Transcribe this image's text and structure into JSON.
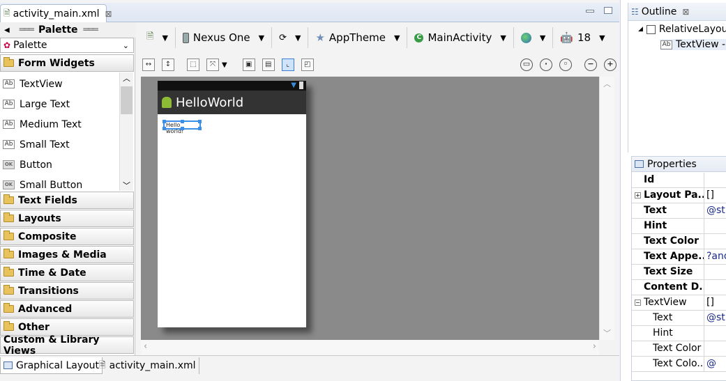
{
  "editor": {
    "tab_label": "activity_main.xml",
    "tab_close": "⊠"
  },
  "palette": {
    "title": "Palette",
    "selector": "Palette",
    "open_category": "Form Widgets",
    "widgets": [
      {
        "label": "TextView",
        "icon": "Ab"
      },
      {
        "label": "Large Text",
        "icon": "Ab"
      },
      {
        "label": "Medium Text",
        "icon": "Ab"
      },
      {
        "label": "Small Text",
        "icon": "Ab"
      },
      {
        "label": "Button",
        "icon": "OK"
      },
      {
        "label": "Small Button",
        "icon": "OK"
      }
    ],
    "categories": [
      "Text Fields",
      "Layouts",
      "Composite",
      "Images & Media",
      "Time & Date",
      "Transitions",
      "Advanced",
      "Other"
    ],
    "custom_views": "Custom & Library Views"
  },
  "toolbar": {
    "device": "Nexus One",
    "theme": "AppTheme",
    "activity": "MainActivity",
    "api_level": "18"
  },
  "device_preview": {
    "app_title": "HelloWorld",
    "hello_text": "Hello world!"
  },
  "bottom_tabs": {
    "graphical": "Graphical Layout",
    "xml": "activity_main.xml"
  },
  "outline": {
    "title": "Outline",
    "root": "RelativeLayou",
    "child": "TextView -"
  },
  "properties": {
    "title": "Properties",
    "rows": [
      {
        "name": "Id",
        "value": "",
        "bold": true
      },
      {
        "name": "Layout Pa...",
        "value": "[]",
        "bold": true,
        "expander": "+"
      },
      {
        "name": "Text",
        "value": "@str",
        "bold": true
      },
      {
        "name": "Hint",
        "value": "",
        "bold": true
      },
      {
        "name": "Text Color",
        "value": "",
        "bold": true
      },
      {
        "name": "Text Appe...",
        "value": "?and",
        "bold": true
      },
      {
        "name": "Text Size",
        "value": "",
        "bold": true
      },
      {
        "name": "Content D...",
        "value": "",
        "bold": true
      },
      {
        "name": "TextView",
        "value": "[]",
        "bold": false,
        "expander": "−"
      },
      {
        "name": "Text",
        "value": "@str",
        "bold": false,
        "indent": true
      },
      {
        "name": "Hint",
        "value": "",
        "bold": false,
        "indent": true
      },
      {
        "name": "Text Color",
        "value": "",
        "bold": false,
        "indent": true
      },
      {
        "name": "Text Colo...",
        "value": "@",
        "bold": false,
        "indent": true
      }
    ]
  }
}
